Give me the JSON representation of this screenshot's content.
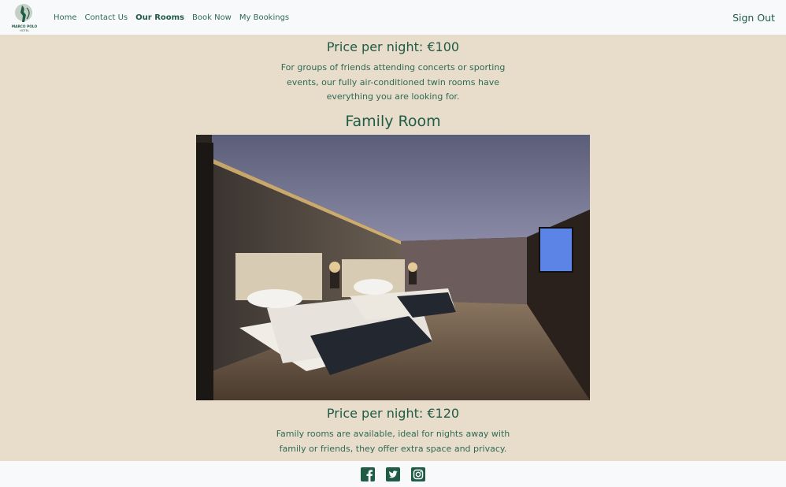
{
  "nav": {
    "logo_text": "MARCO POLO HOTEL",
    "links": [
      {
        "label": "Home"
      },
      {
        "label": "Contact Us"
      },
      {
        "label": "Our Rooms",
        "active": true
      },
      {
        "label": "Book Now"
      },
      {
        "label": "My Bookings"
      }
    ],
    "sign_out": "Sign Out"
  },
  "twin_room": {
    "price": "Price per night: €100",
    "description": "For groups of friends attending concerts or sporting events, our fully air-conditioned twin rooms have everything you are looking for."
  },
  "family_room": {
    "title": "Family Room",
    "price": "Price per night: €120",
    "description": "Family rooms are available, ideal for nights away with family or friends, they offer extra space and privacy."
  },
  "footer": {
    "icons": [
      "facebook-icon",
      "twitter-icon",
      "instagram-icon"
    ]
  },
  "colors": {
    "page_bg": "#e8dccb",
    "nav_bg": "#f8f9fa",
    "brand_green": "#1f5b45"
  }
}
